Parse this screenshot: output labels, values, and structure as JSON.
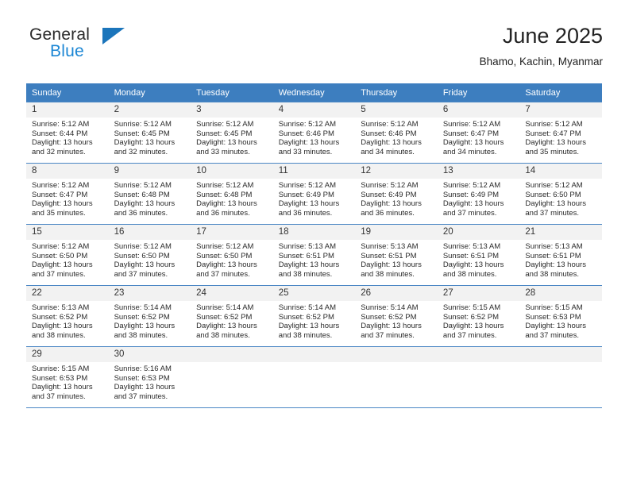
{
  "brand": {
    "name_part1": "General",
    "name_part2": "Blue",
    "triangle_color": "#1b75bb",
    "blue_text_color": "#1b86d4"
  },
  "header": {
    "title": "June 2025",
    "subtitle": "Bhamo, Kachin, Myanmar"
  },
  "theme": {
    "header_blue": "#3d7ebf",
    "grid_line": "#4a86c4",
    "daynum_bg": "#f2f2f2"
  },
  "weekdays": [
    "Sunday",
    "Monday",
    "Tuesday",
    "Wednesday",
    "Thursday",
    "Friday",
    "Saturday"
  ],
  "calendar": {
    "weeks": [
      [
        {
          "day": "1",
          "sunrise": "Sunrise: 5:12 AM",
          "sunset": "Sunset: 6:44 PM",
          "daylight1": "Daylight: 13 hours",
          "daylight2": "and 32 minutes."
        },
        {
          "day": "2",
          "sunrise": "Sunrise: 5:12 AM",
          "sunset": "Sunset: 6:45 PM",
          "daylight1": "Daylight: 13 hours",
          "daylight2": "and 32 minutes."
        },
        {
          "day": "3",
          "sunrise": "Sunrise: 5:12 AM",
          "sunset": "Sunset: 6:45 PM",
          "daylight1": "Daylight: 13 hours",
          "daylight2": "and 33 minutes."
        },
        {
          "day": "4",
          "sunrise": "Sunrise: 5:12 AM",
          "sunset": "Sunset: 6:46 PM",
          "daylight1": "Daylight: 13 hours",
          "daylight2": "and 33 minutes."
        },
        {
          "day": "5",
          "sunrise": "Sunrise: 5:12 AM",
          "sunset": "Sunset: 6:46 PM",
          "daylight1": "Daylight: 13 hours",
          "daylight2": "and 34 minutes."
        },
        {
          "day": "6",
          "sunrise": "Sunrise: 5:12 AM",
          "sunset": "Sunset: 6:47 PM",
          "daylight1": "Daylight: 13 hours",
          "daylight2": "and 34 minutes."
        },
        {
          "day": "7",
          "sunrise": "Sunrise: 5:12 AM",
          "sunset": "Sunset: 6:47 PM",
          "daylight1": "Daylight: 13 hours",
          "daylight2": "and 35 minutes."
        }
      ],
      [
        {
          "day": "8",
          "sunrise": "Sunrise: 5:12 AM",
          "sunset": "Sunset: 6:47 PM",
          "daylight1": "Daylight: 13 hours",
          "daylight2": "and 35 minutes."
        },
        {
          "day": "9",
          "sunrise": "Sunrise: 5:12 AM",
          "sunset": "Sunset: 6:48 PM",
          "daylight1": "Daylight: 13 hours",
          "daylight2": "and 36 minutes."
        },
        {
          "day": "10",
          "sunrise": "Sunrise: 5:12 AM",
          "sunset": "Sunset: 6:48 PM",
          "daylight1": "Daylight: 13 hours",
          "daylight2": "and 36 minutes."
        },
        {
          "day": "11",
          "sunrise": "Sunrise: 5:12 AM",
          "sunset": "Sunset: 6:49 PM",
          "daylight1": "Daylight: 13 hours",
          "daylight2": "and 36 minutes."
        },
        {
          "day": "12",
          "sunrise": "Sunrise: 5:12 AM",
          "sunset": "Sunset: 6:49 PM",
          "daylight1": "Daylight: 13 hours",
          "daylight2": "and 36 minutes."
        },
        {
          "day": "13",
          "sunrise": "Sunrise: 5:12 AM",
          "sunset": "Sunset: 6:49 PM",
          "daylight1": "Daylight: 13 hours",
          "daylight2": "and 37 minutes."
        },
        {
          "day": "14",
          "sunrise": "Sunrise: 5:12 AM",
          "sunset": "Sunset: 6:50 PM",
          "daylight1": "Daylight: 13 hours",
          "daylight2": "and 37 minutes."
        }
      ],
      [
        {
          "day": "15",
          "sunrise": "Sunrise: 5:12 AM",
          "sunset": "Sunset: 6:50 PM",
          "daylight1": "Daylight: 13 hours",
          "daylight2": "and 37 minutes."
        },
        {
          "day": "16",
          "sunrise": "Sunrise: 5:12 AM",
          "sunset": "Sunset: 6:50 PM",
          "daylight1": "Daylight: 13 hours",
          "daylight2": "and 37 minutes."
        },
        {
          "day": "17",
          "sunrise": "Sunrise: 5:12 AM",
          "sunset": "Sunset: 6:50 PM",
          "daylight1": "Daylight: 13 hours",
          "daylight2": "and 37 minutes."
        },
        {
          "day": "18",
          "sunrise": "Sunrise: 5:13 AM",
          "sunset": "Sunset: 6:51 PM",
          "daylight1": "Daylight: 13 hours",
          "daylight2": "and 38 minutes."
        },
        {
          "day": "19",
          "sunrise": "Sunrise: 5:13 AM",
          "sunset": "Sunset: 6:51 PM",
          "daylight1": "Daylight: 13 hours",
          "daylight2": "and 38 minutes."
        },
        {
          "day": "20",
          "sunrise": "Sunrise: 5:13 AM",
          "sunset": "Sunset: 6:51 PM",
          "daylight1": "Daylight: 13 hours",
          "daylight2": "and 38 minutes."
        },
        {
          "day": "21",
          "sunrise": "Sunrise: 5:13 AM",
          "sunset": "Sunset: 6:51 PM",
          "daylight1": "Daylight: 13 hours",
          "daylight2": "and 38 minutes."
        }
      ],
      [
        {
          "day": "22",
          "sunrise": "Sunrise: 5:13 AM",
          "sunset": "Sunset: 6:52 PM",
          "daylight1": "Daylight: 13 hours",
          "daylight2": "and 38 minutes."
        },
        {
          "day": "23",
          "sunrise": "Sunrise: 5:14 AM",
          "sunset": "Sunset: 6:52 PM",
          "daylight1": "Daylight: 13 hours",
          "daylight2": "and 38 minutes."
        },
        {
          "day": "24",
          "sunrise": "Sunrise: 5:14 AM",
          "sunset": "Sunset: 6:52 PM",
          "daylight1": "Daylight: 13 hours",
          "daylight2": "and 38 minutes."
        },
        {
          "day": "25",
          "sunrise": "Sunrise: 5:14 AM",
          "sunset": "Sunset: 6:52 PM",
          "daylight1": "Daylight: 13 hours",
          "daylight2": "and 38 minutes."
        },
        {
          "day": "26",
          "sunrise": "Sunrise: 5:14 AM",
          "sunset": "Sunset: 6:52 PM",
          "daylight1": "Daylight: 13 hours",
          "daylight2": "and 37 minutes."
        },
        {
          "day": "27",
          "sunrise": "Sunrise: 5:15 AM",
          "sunset": "Sunset: 6:52 PM",
          "daylight1": "Daylight: 13 hours",
          "daylight2": "and 37 minutes."
        },
        {
          "day": "28",
          "sunrise": "Sunrise: 5:15 AM",
          "sunset": "Sunset: 6:53 PM",
          "daylight1": "Daylight: 13 hours",
          "daylight2": "and 37 minutes."
        }
      ],
      [
        {
          "day": "29",
          "sunrise": "Sunrise: 5:15 AM",
          "sunset": "Sunset: 6:53 PM",
          "daylight1": "Daylight: 13 hours",
          "daylight2": "and 37 minutes."
        },
        {
          "day": "30",
          "sunrise": "Sunrise: 5:16 AM",
          "sunset": "Sunset: 6:53 PM",
          "daylight1": "Daylight: 13 hours",
          "daylight2": "and 37 minutes."
        },
        {
          "day": "",
          "sunrise": "",
          "sunset": "",
          "daylight1": "",
          "daylight2": ""
        },
        {
          "day": "",
          "sunrise": "",
          "sunset": "",
          "daylight1": "",
          "daylight2": ""
        },
        {
          "day": "",
          "sunrise": "",
          "sunset": "",
          "daylight1": "",
          "daylight2": ""
        },
        {
          "day": "",
          "sunrise": "",
          "sunset": "",
          "daylight1": "",
          "daylight2": ""
        },
        {
          "day": "",
          "sunrise": "",
          "sunset": "",
          "daylight1": "",
          "daylight2": ""
        }
      ]
    ]
  }
}
